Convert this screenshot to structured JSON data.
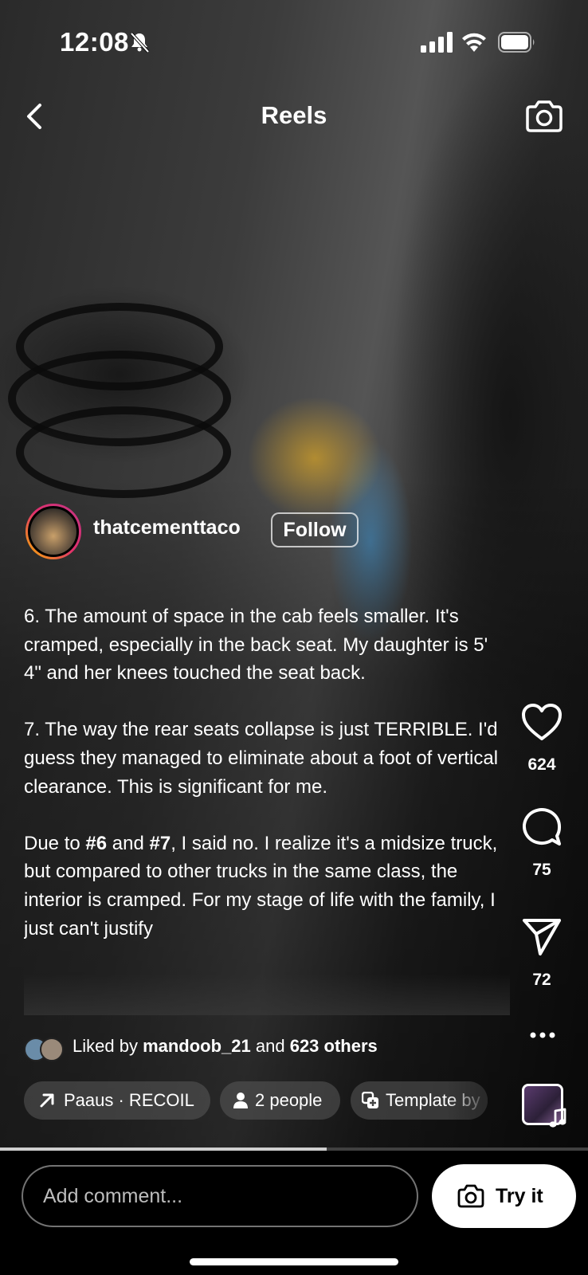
{
  "status_bar": {
    "time": "12:08"
  },
  "header": {
    "title": "Reels"
  },
  "post": {
    "username": "thatcementtaco",
    "follow_label": "Follow",
    "caption": {
      "para1": "6. The amount of space in the cab feels smaller. It's cramped, especially in the back seat. My daughter is 5' 4\" and her knees touched the seat back.",
      "para2": "7. The way the rear seats collapse is just TERRIBLE. I'd guess they managed to eliminate about a foot of vertical clearance. This is significant for me.",
      "para3_pre": "Due to ",
      "para3_b1": "#6",
      "para3_mid": " and ",
      "para3_b2": "#7",
      "para3_post": ", I said no. I realize it's a midsize truck, but compared to other trucks in the same class, the interior is cramped. For my stage of life with the family, I just can't justify"
    },
    "liked_by": {
      "prefix": "Liked by ",
      "user": "mandoob_21",
      "and": " and ",
      "others": "623 others"
    }
  },
  "actions": {
    "likes": "624",
    "comments": "75",
    "shares": "72"
  },
  "chips": {
    "audio": "Paaus · RECOIL",
    "people": "2 people",
    "template": "Template by"
  },
  "progress": {
    "fraction": 0.555
  },
  "bottom": {
    "comment_placeholder": "Add comment...",
    "try_label": "Try it"
  },
  "colors": {
    "background": "#000000",
    "avatar_ring_start": "#f7b500",
    "avatar_ring_end": "#c13584"
  }
}
